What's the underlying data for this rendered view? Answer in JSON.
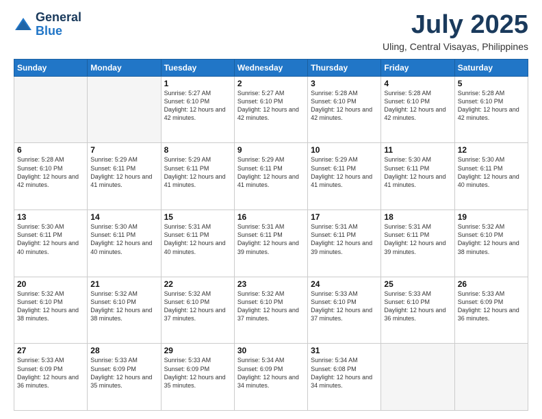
{
  "logo": {
    "general": "General",
    "blue": "Blue"
  },
  "header": {
    "month": "July 2025",
    "location": "Uling, Central Visayas, Philippines"
  },
  "weekdays": [
    "Sunday",
    "Monday",
    "Tuesday",
    "Wednesday",
    "Thursday",
    "Friday",
    "Saturday"
  ],
  "weeks": [
    [
      {
        "day": "",
        "info": ""
      },
      {
        "day": "",
        "info": ""
      },
      {
        "day": "1",
        "info": "Sunrise: 5:27 AM\nSunset: 6:10 PM\nDaylight: 12 hours and 42 minutes."
      },
      {
        "day": "2",
        "info": "Sunrise: 5:27 AM\nSunset: 6:10 PM\nDaylight: 12 hours and 42 minutes."
      },
      {
        "day": "3",
        "info": "Sunrise: 5:28 AM\nSunset: 6:10 PM\nDaylight: 12 hours and 42 minutes."
      },
      {
        "day": "4",
        "info": "Sunrise: 5:28 AM\nSunset: 6:10 PM\nDaylight: 12 hours and 42 minutes."
      },
      {
        "day": "5",
        "info": "Sunrise: 5:28 AM\nSunset: 6:10 PM\nDaylight: 12 hours and 42 minutes."
      }
    ],
    [
      {
        "day": "6",
        "info": "Sunrise: 5:28 AM\nSunset: 6:10 PM\nDaylight: 12 hours and 42 minutes."
      },
      {
        "day": "7",
        "info": "Sunrise: 5:29 AM\nSunset: 6:11 PM\nDaylight: 12 hours and 41 minutes."
      },
      {
        "day": "8",
        "info": "Sunrise: 5:29 AM\nSunset: 6:11 PM\nDaylight: 12 hours and 41 minutes."
      },
      {
        "day": "9",
        "info": "Sunrise: 5:29 AM\nSunset: 6:11 PM\nDaylight: 12 hours and 41 minutes."
      },
      {
        "day": "10",
        "info": "Sunrise: 5:29 AM\nSunset: 6:11 PM\nDaylight: 12 hours and 41 minutes."
      },
      {
        "day": "11",
        "info": "Sunrise: 5:30 AM\nSunset: 6:11 PM\nDaylight: 12 hours and 41 minutes."
      },
      {
        "day": "12",
        "info": "Sunrise: 5:30 AM\nSunset: 6:11 PM\nDaylight: 12 hours and 40 minutes."
      }
    ],
    [
      {
        "day": "13",
        "info": "Sunrise: 5:30 AM\nSunset: 6:11 PM\nDaylight: 12 hours and 40 minutes."
      },
      {
        "day": "14",
        "info": "Sunrise: 5:30 AM\nSunset: 6:11 PM\nDaylight: 12 hours and 40 minutes."
      },
      {
        "day": "15",
        "info": "Sunrise: 5:31 AM\nSunset: 6:11 PM\nDaylight: 12 hours and 40 minutes."
      },
      {
        "day": "16",
        "info": "Sunrise: 5:31 AM\nSunset: 6:11 PM\nDaylight: 12 hours and 39 minutes."
      },
      {
        "day": "17",
        "info": "Sunrise: 5:31 AM\nSunset: 6:11 PM\nDaylight: 12 hours and 39 minutes."
      },
      {
        "day": "18",
        "info": "Sunrise: 5:31 AM\nSunset: 6:11 PM\nDaylight: 12 hours and 39 minutes."
      },
      {
        "day": "19",
        "info": "Sunrise: 5:32 AM\nSunset: 6:10 PM\nDaylight: 12 hours and 38 minutes."
      }
    ],
    [
      {
        "day": "20",
        "info": "Sunrise: 5:32 AM\nSunset: 6:10 PM\nDaylight: 12 hours and 38 minutes."
      },
      {
        "day": "21",
        "info": "Sunrise: 5:32 AM\nSunset: 6:10 PM\nDaylight: 12 hours and 38 minutes."
      },
      {
        "day": "22",
        "info": "Sunrise: 5:32 AM\nSunset: 6:10 PM\nDaylight: 12 hours and 37 minutes."
      },
      {
        "day": "23",
        "info": "Sunrise: 5:32 AM\nSunset: 6:10 PM\nDaylight: 12 hours and 37 minutes."
      },
      {
        "day": "24",
        "info": "Sunrise: 5:33 AM\nSunset: 6:10 PM\nDaylight: 12 hours and 37 minutes."
      },
      {
        "day": "25",
        "info": "Sunrise: 5:33 AM\nSunset: 6:10 PM\nDaylight: 12 hours and 36 minutes."
      },
      {
        "day": "26",
        "info": "Sunrise: 5:33 AM\nSunset: 6:09 PM\nDaylight: 12 hours and 36 minutes."
      }
    ],
    [
      {
        "day": "27",
        "info": "Sunrise: 5:33 AM\nSunset: 6:09 PM\nDaylight: 12 hours and 36 minutes."
      },
      {
        "day": "28",
        "info": "Sunrise: 5:33 AM\nSunset: 6:09 PM\nDaylight: 12 hours and 35 minutes."
      },
      {
        "day": "29",
        "info": "Sunrise: 5:33 AM\nSunset: 6:09 PM\nDaylight: 12 hours and 35 minutes."
      },
      {
        "day": "30",
        "info": "Sunrise: 5:34 AM\nSunset: 6:09 PM\nDaylight: 12 hours and 34 minutes."
      },
      {
        "day": "31",
        "info": "Sunrise: 5:34 AM\nSunset: 6:08 PM\nDaylight: 12 hours and 34 minutes."
      },
      {
        "day": "",
        "info": ""
      },
      {
        "day": "",
        "info": ""
      }
    ]
  ]
}
